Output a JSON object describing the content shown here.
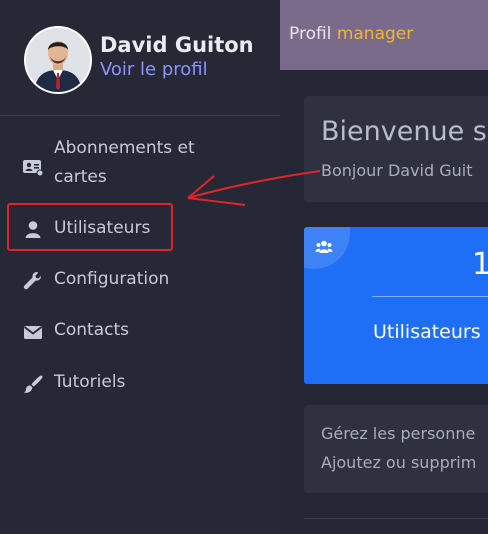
{
  "profile": {
    "name": "David Guiton",
    "view_profile": "Voir le profil"
  },
  "sidebar": {
    "items": [
      {
        "line1": "Abonnements et",
        "line2": "cartes",
        "icon": "id-card-icon"
      },
      {
        "label": "Utilisateurs",
        "icon": "user-icon"
      },
      {
        "label": "Configuration",
        "icon": "wrench-icon"
      },
      {
        "label": "Contacts",
        "icon": "envelope-icon"
      },
      {
        "label": "Tutoriels",
        "icon": "brush-icon"
      }
    ]
  },
  "topbar": {
    "title_plain": "Profil",
    "title_accent": "manager"
  },
  "welcome": {
    "title": "Bienvenue s",
    "subtitle": "Bonjour David Guit"
  },
  "stat": {
    "value": "1",
    "label": "Utilisateurs"
  },
  "info": {
    "line1": "Gérez les personne",
    "line2": "Ajoutez ou supprim"
  },
  "colors": {
    "sidebar_bg": "#262836",
    "topbar_bg": "#7a6b8a",
    "accent": "#f5b52a",
    "link": "#8b93ff",
    "stat_card": "#1e6ff5",
    "annotation": "#e0252a"
  }
}
